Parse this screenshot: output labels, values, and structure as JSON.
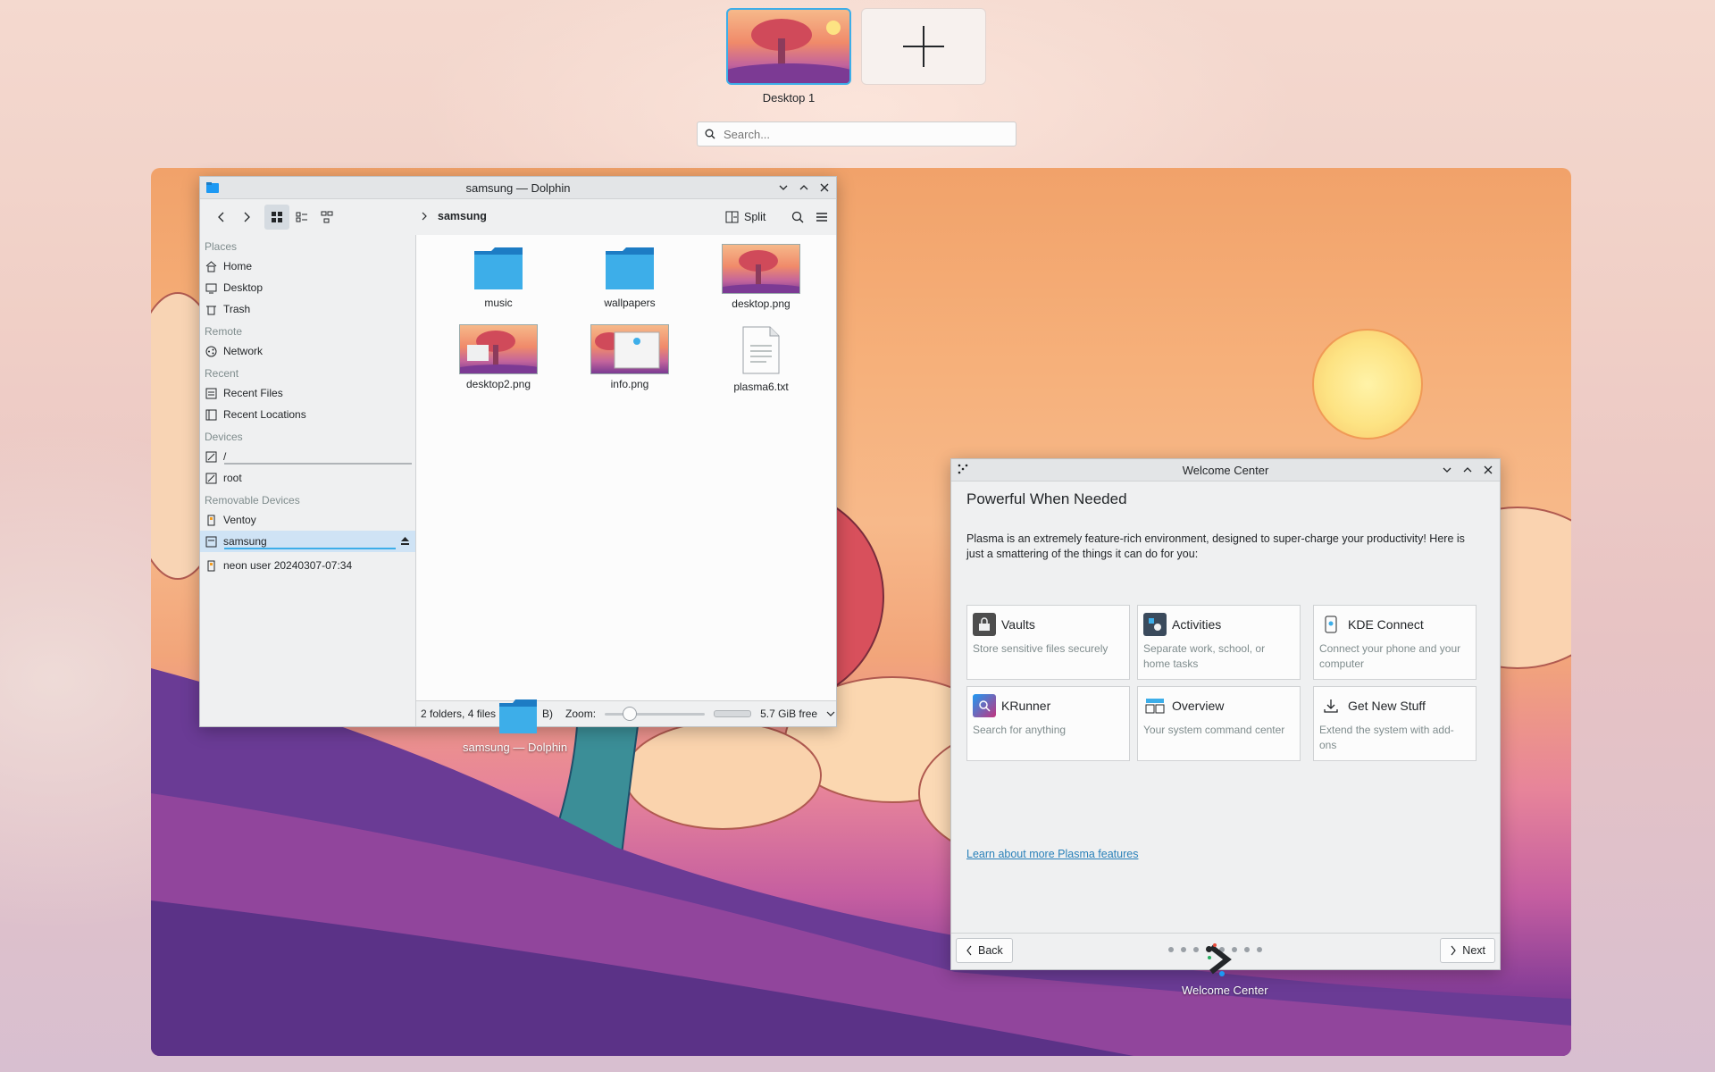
{
  "overview": {
    "desktops": [
      {
        "label": "Desktop 1"
      }
    ],
    "search_placeholder": "Search..."
  },
  "dolphin": {
    "title": "samsung — Dolphin",
    "breadcrumb": "samsung",
    "split_label": "Split",
    "sidebar": {
      "places_header": "Places",
      "places": [
        "Home",
        "Desktop",
        "Trash"
      ],
      "remote_header": "Remote",
      "remote": [
        "Network"
      ],
      "recent_header": "Recent",
      "recent": [
        "Recent Files",
        "Recent Locations"
      ],
      "devices_header": "Devices",
      "devices": [
        "/",
        "root"
      ],
      "removable_header": "Removable Devices",
      "removable": [
        "Ventoy",
        "samsung",
        "neon user 20240307-07:34"
      ]
    },
    "files": [
      {
        "name": "music",
        "type": "folder"
      },
      {
        "name": "wallpapers",
        "type": "folder"
      },
      {
        "name": "desktop.png",
        "type": "image"
      },
      {
        "name": "desktop2.png",
        "type": "image"
      },
      {
        "name": "info.png",
        "type": "image"
      },
      {
        "name": "plasma6.txt",
        "type": "text"
      }
    ],
    "status": {
      "summary": "2 folders, 4 files",
      "summary_tail": "B)",
      "zoom_label": "Zoom:",
      "free_space": "5.7 GiB free"
    },
    "caption": "samsung — Dolphin"
  },
  "welcome": {
    "title": "Welcome Center",
    "heading": "Powerful When Needed",
    "intro": "Plasma is an extremely feature-rich environment, designed to super-charge your productivity! Here is just a smattering of the things it can do for you:",
    "cards": [
      {
        "title": "Vaults",
        "desc": "Store sensitive files securely"
      },
      {
        "title": "Activities",
        "desc": "Separate work, school, or home tasks"
      },
      {
        "title": "KDE Connect",
        "desc": "Connect your phone and your computer"
      },
      {
        "title": "KRunner",
        "desc": "Search for anything"
      },
      {
        "title": "Overview",
        "desc": "Your system command center"
      },
      {
        "title": "Get New Stuff",
        "desc": "Extend the system with add-ons"
      }
    ],
    "link": "Learn about more Plasma features",
    "back_label": "Back",
    "next_label": "Next",
    "caption": "Welcome Center"
  },
  "colors": {
    "accent": "#3daee9",
    "link": "#2980b9",
    "selection": "#cfe3f5"
  }
}
